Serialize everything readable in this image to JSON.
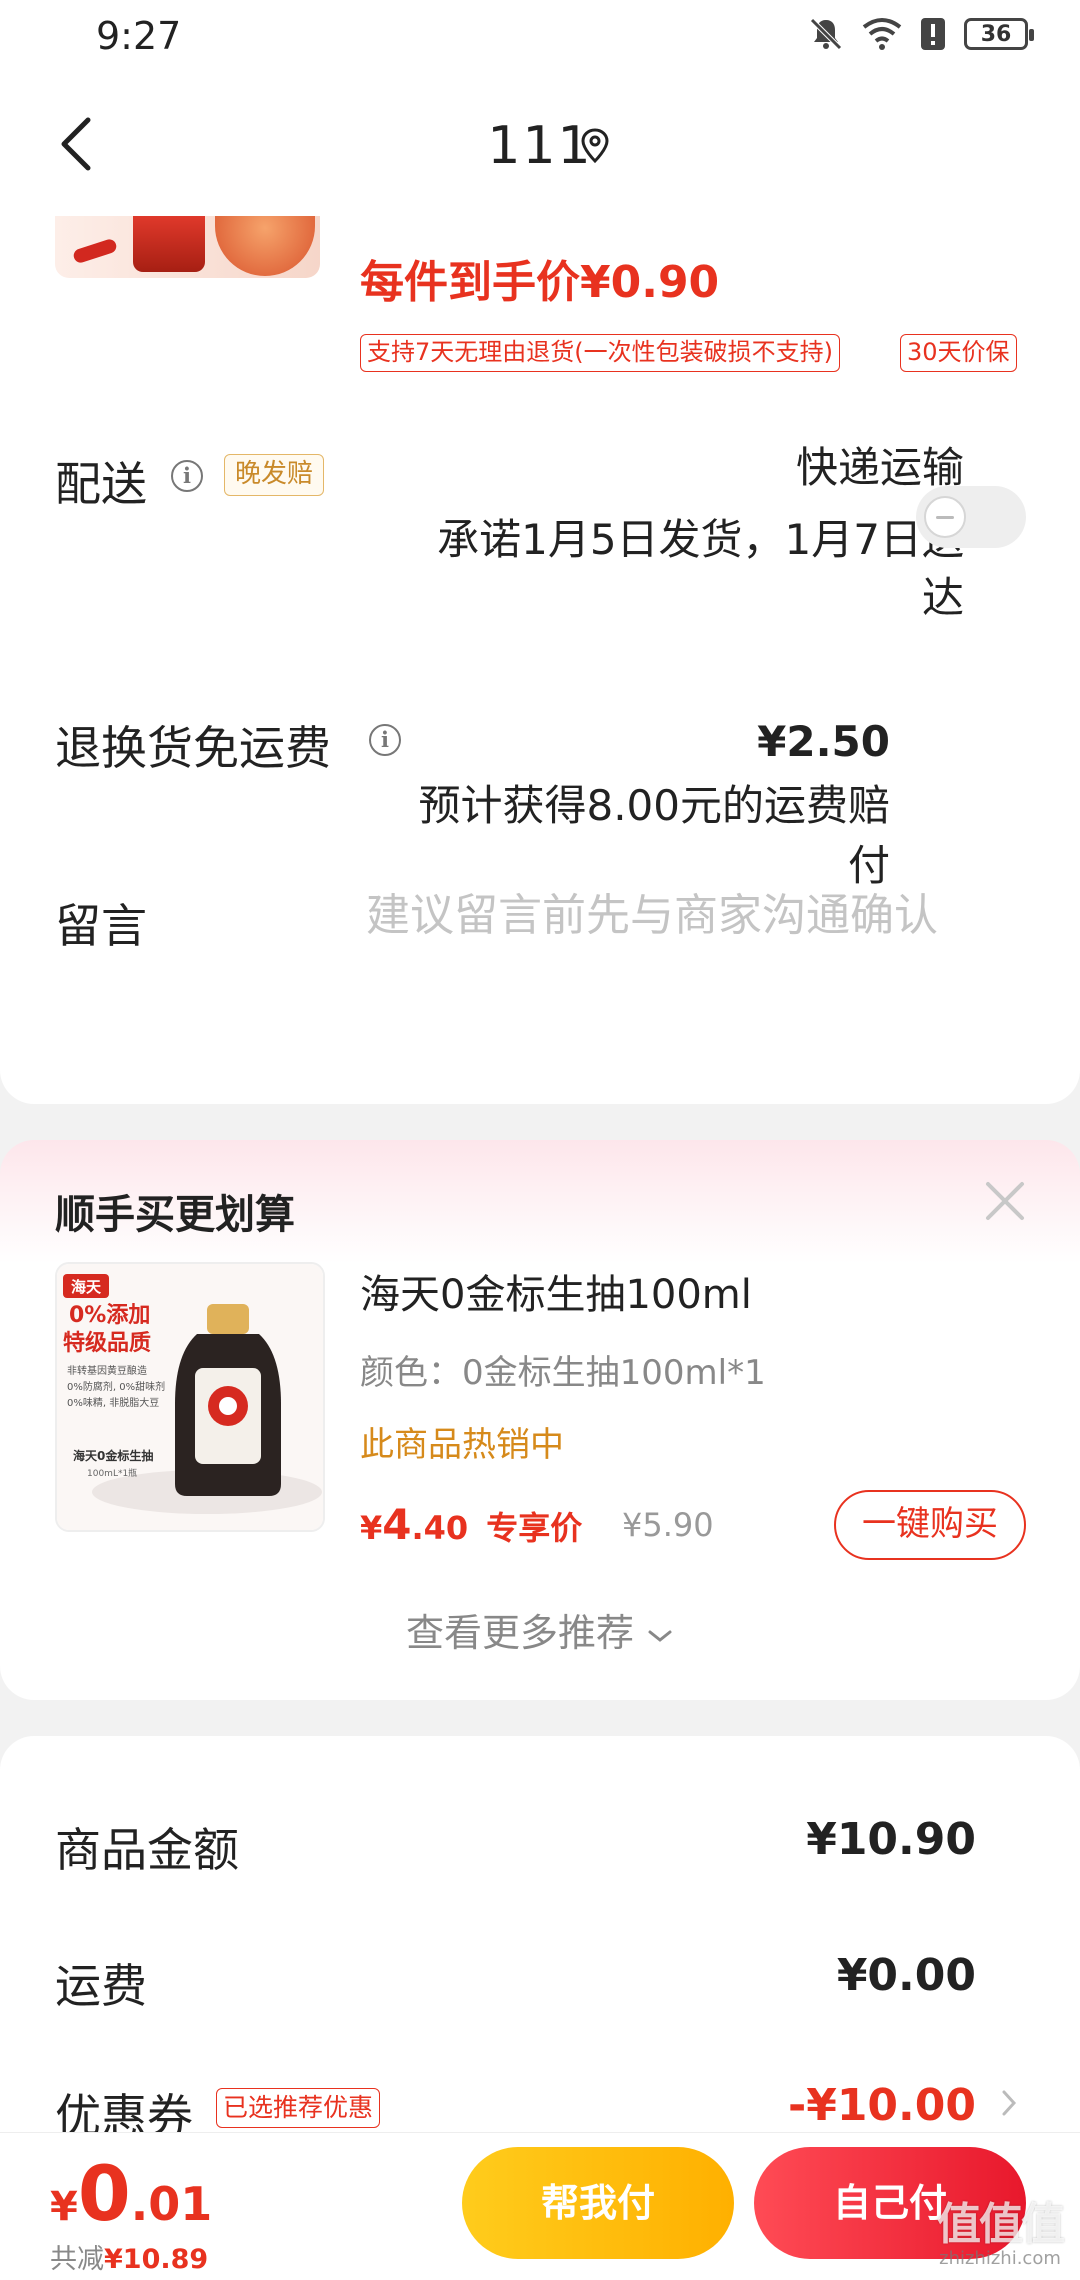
{
  "status_bar": {
    "time": "9:27",
    "battery": "36"
  },
  "nav": {
    "title": "111"
  },
  "product": {
    "unit_price_text": "每件到手价¥0.90",
    "return_tag": "支持7天无理由退货(一次性包装破损不支持)",
    "price_protect_tag": "30天价保"
  },
  "delivery": {
    "label": "配送",
    "late_tag": "晚发赔",
    "method": "快递运输",
    "promise_line1": "承诺1月5日发货，1月7日送",
    "promise_line2": "达"
  },
  "return_shipping": {
    "label": "退换货免运费",
    "price": "¥2.50",
    "desc_line1": "预计获得8.00元的运费赔",
    "desc_line2": "付",
    "enabled": false
  },
  "message": {
    "label": "留言",
    "placeholder": "建议留言前先与商家沟通确认"
  },
  "recommend": {
    "title": "顺手买更划算",
    "item": {
      "name": "海天0金标生抽100ml",
      "color": "颜色：0金标生抽100ml*1",
      "hot": "此商品热销中",
      "price_currency": "¥",
      "price_int": "4",
      "price_dec": ".40",
      "price_tag": "专享价",
      "original_price": "¥5.90",
      "buy_label": "一键购买",
      "thumb_brand": "海天",
      "thumb_headline1": "0%添加",
      "thumb_headline2": "特级品质",
      "thumb_line1": "非转基因黄豆酿造",
      "thumb_line2": "0%防腐剂, 0%甜味剂",
      "thumb_line3": "0%味精, 非脱脂大豆",
      "thumb_product": "海天0金标生抽",
      "thumb_spec": "100mL*1瓶"
    },
    "more_label": "查看更多推荐"
  },
  "summary": {
    "goods_label": "商品金额",
    "goods_value": "¥10.90",
    "shipping_label": "运费",
    "shipping_value": "¥0.00",
    "coupon_label": "优惠券",
    "coupon_tag": "已选推荐优惠",
    "coupon_value": "-¥10.00"
  },
  "bottom": {
    "total_currency": "¥",
    "total_int": "0",
    "total_dec": ".01",
    "saved_prefix": "共减",
    "saved_value": "¥10.89",
    "help_pay_label": "帮我付",
    "self_pay_label": "自己付",
    "watermark_logo": "值值值",
    "watermark_site": "zhizhizhi.com"
  },
  "colors": {
    "accent": "#e8321f",
    "help_btn": "#ffbd0a",
    "self_btn": "#ee2a3a"
  }
}
